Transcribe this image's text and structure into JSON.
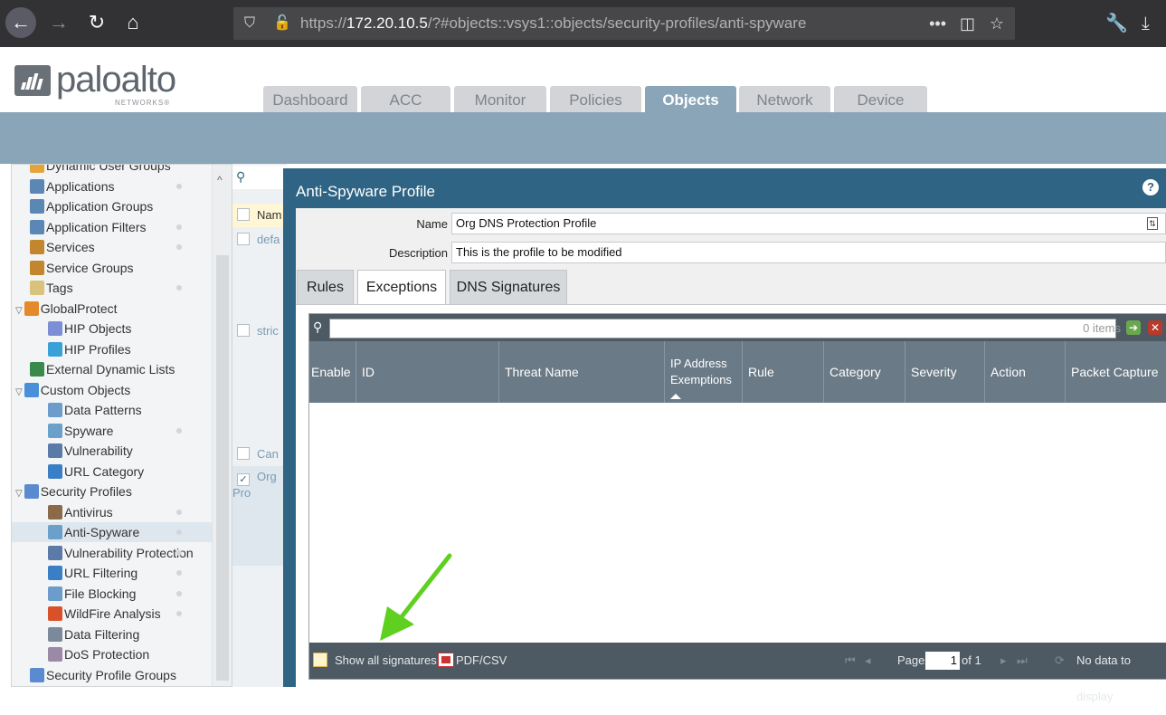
{
  "browser": {
    "url_scheme": "https://",
    "url_host": "172.20.10.5",
    "url_path": "/?#objects::vsys1::objects/security-profiles/anti-spyware",
    "menu_glyph": "•••"
  },
  "logo": {
    "text": "paloalto",
    "sub": "NETWORKS®"
  },
  "tabs": [
    {
      "label": "Dashboard"
    },
    {
      "label": "ACC"
    },
    {
      "label": "Monitor"
    },
    {
      "label": "Policies"
    },
    {
      "label": "Objects",
      "active": true
    },
    {
      "label": "Network"
    },
    {
      "label": "Device"
    }
  ],
  "tree": [
    {
      "label": "Dynamic User Groups",
      "icon": "user-group-icon",
      "color": "#e5a43b",
      "level": 1
    },
    {
      "label": "Applications",
      "icon": "application-icon",
      "color": "#5b87b5",
      "level": 1,
      "dot": true
    },
    {
      "label": "Application Groups",
      "icon": "application-group-icon",
      "color": "#5b87b5",
      "level": 1
    },
    {
      "label": "Application Filters",
      "icon": "application-filter-icon",
      "color": "#5b87b5",
      "level": 1,
      "dot": true
    },
    {
      "label": "Services",
      "icon": "services-icon",
      "color": "#c2862f",
      "level": 1,
      "dot": true
    },
    {
      "label": "Service Groups",
      "icon": "service-group-icon",
      "color": "#c2862f",
      "level": 1
    },
    {
      "label": "Tags",
      "icon": "tag-icon",
      "color": "#d9c27a",
      "level": 1,
      "dot": true
    },
    {
      "label": "GlobalProtect",
      "icon": "globalprotect-icon",
      "color": "#e48a2a",
      "level": 0,
      "expand": "▽"
    },
    {
      "label": "HIP Objects",
      "icon": "hip-object-icon",
      "color": "#7c8fd6",
      "level": 2
    },
    {
      "label": "HIP Profiles",
      "icon": "hip-profile-icon",
      "color": "#3aa0d8",
      "level": 2
    },
    {
      "label": "External Dynamic Lists",
      "icon": "external-list-icon",
      "color": "#3a8a4c",
      "level": 1
    },
    {
      "label": "Custom Objects",
      "icon": "custom-objects-icon",
      "color": "#4a90d9",
      "level": 0,
      "expand": "▽"
    },
    {
      "label": "Data Patterns",
      "icon": "data-pattern-icon",
      "color": "#6c9ccc",
      "level": 2
    },
    {
      "label": "Spyware",
      "icon": "spyware-icon",
      "color": "#6aa0c9",
      "level": 2,
      "dot": true
    },
    {
      "label": "Vulnerability",
      "icon": "vulnerability-icon",
      "color": "#5a7aa8",
      "level": 2
    },
    {
      "label": "URL Category",
      "icon": "url-category-icon",
      "color": "#3a7ec6",
      "level": 2
    },
    {
      "label": "Security Profiles",
      "icon": "security-profiles-icon",
      "color": "#5a8ad0",
      "level": 0,
      "expand": "▽"
    },
    {
      "label": "Antivirus",
      "icon": "antivirus-icon",
      "color": "#8a6a4a",
      "level": 2,
      "dot": true
    },
    {
      "label": "Anti-Spyware",
      "icon": "anti-spyware-icon",
      "color": "#6aa0c9",
      "level": 2,
      "dot": true,
      "selected": true
    },
    {
      "label": "Vulnerability Protection",
      "icon": "vulnerability-protection-icon",
      "color": "#5a7aa8",
      "level": 2,
      "dot": true
    },
    {
      "label": "URL Filtering",
      "icon": "url-filtering-icon",
      "color": "#3a7ec6",
      "level": 2,
      "dot": true
    },
    {
      "label": "File Blocking",
      "icon": "file-blocking-icon",
      "color": "#6c9ccc",
      "level": 2,
      "dot": true
    },
    {
      "label": "WildFire Analysis",
      "icon": "wildfire-icon",
      "color": "#d9512a",
      "level": 2,
      "dot": true
    },
    {
      "label": "Data Filtering",
      "icon": "data-filtering-icon",
      "color": "#7a8a9a",
      "level": 2
    },
    {
      "label": "DoS Protection",
      "icon": "dos-protection-icon",
      "color": "#9a8aa8",
      "level": 2
    },
    {
      "label": "Security Profile Groups",
      "icon": "security-profile-group-icon",
      "color": "#5a8ad0",
      "level": 1
    }
  ],
  "bg_grid": {
    "header": "Nam",
    "rows": [
      "defa",
      "stric",
      "Can",
      "Org Pro"
    ]
  },
  "dialog": {
    "title": "Anti-Spyware Profile",
    "help": "?",
    "name_label": "Name",
    "name_value": "Org DNS Protection Profile",
    "desc_label": "Description",
    "desc_value": "This is the profile to be modified",
    "tabs": [
      "Rules",
      "Exceptions",
      "DNS Signatures"
    ],
    "active_tab": "Exceptions"
  },
  "grid": {
    "items_text": "0 items",
    "columns": [
      "Enable",
      "ID",
      "Threat Name",
      "IP Address Exemptions",
      "Rule",
      "Category",
      "Severity",
      "Action",
      "Packet Capture"
    ],
    "footer": {
      "show_all": "Show all signatures",
      "pdf": "PDF/CSV",
      "page_label": "Page",
      "page_value": "1",
      "of": "of 1",
      "no_data": "No data to display"
    }
  },
  "colors": {
    "brand_blue": "#2f6484",
    "header_band": "#8aa5b8",
    "annotation_arrow": "#5fd01f"
  }
}
